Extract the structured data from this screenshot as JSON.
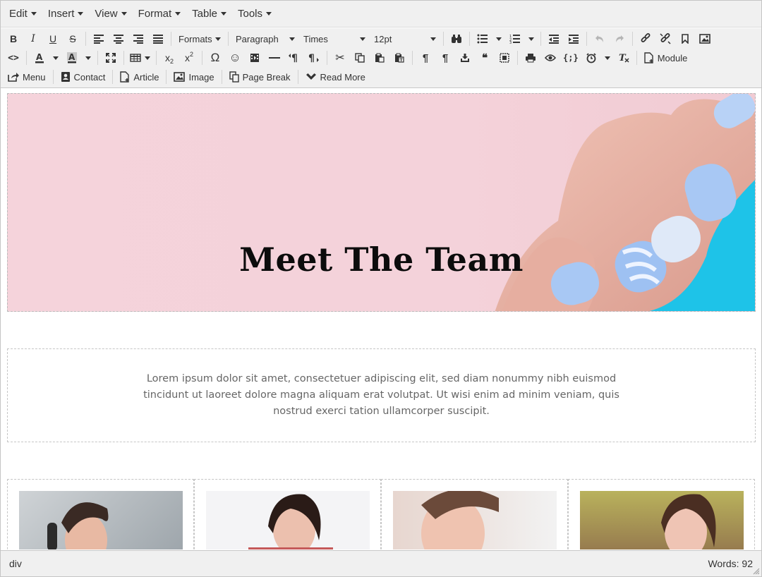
{
  "menubar": {
    "items": [
      {
        "label": "Edit"
      },
      {
        "label": "Insert"
      },
      {
        "label": "View"
      },
      {
        "label": "Format"
      },
      {
        "label": "Table"
      },
      {
        "label": "Tools"
      }
    ]
  },
  "toolbar": {
    "bold": "B",
    "italic": "I",
    "underline": "U",
    "strike": "S",
    "formats": "Formats",
    "block": "Paragraph",
    "font": "Times",
    "size": "12pt",
    "code": "<>",
    "sub": "x",
    "sup": "x",
    "omega": "Ω",
    "emoji": "☺",
    "menu_label": "Menu",
    "contact_label": "Contact",
    "article_label": "Article",
    "image_label": "Image",
    "pagebreak_label": "Page Break",
    "readmore_label": "Read More",
    "module_label": "Module",
    "quote": "66",
    "codesample": "{;}"
  },
  "content": {
    "hero_title": "Meet The Team",
    "lorem": "Lorem ipsum dolor sit amet, consectetuer adipiscing elit, sed diam nonummy nibh euismod tincidunt ut laoreet dolore magna aliquam erat volutpat. Ut wisi enim ad minim veniam, quis nostrud exerci tation ullamcorper suscipit."
  },
  "statusbar": {
    "path": "div",
    "words": "Words: 92"
  },
  "colors": {
    "hero_bg": "#f5d3db",
    "accent_blue": "#1ec3e8",
    "nail_blue": "#a8c8f4"
  }
}
